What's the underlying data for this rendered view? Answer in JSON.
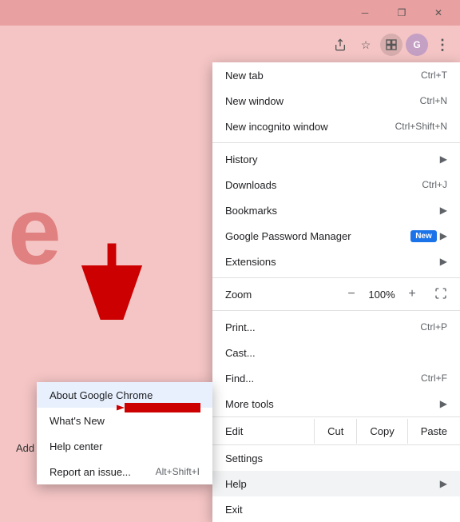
{
  "titleBar": {
    "minimizeLabel": "─",
    "restoreLabel": "❐",
    "closeLabel": "✕"
  },
  "toolbar": {
    "shareIcon": "↑",
    "favoriteIcon": "☆",
    "extensionIcon": "⬜",
    "profileIcon": "●",
    "menuIcon": "⋮"
  },
  "page": {
    "letter": "e",
    "addShortcut": "Add shortcut"
  },
  "mainMenu": {
    "items": [
      {
        "label": "New tab",
        "shortcut": "Ctrl+T",
        "arrow": false
      },
      {
        "label": "New window",
        "shortcut": "Ctrl+N",
        "arrow": false
      },
      {
        "label": "New incognito window",
        "shortcut": "Ctrl+Shift+N",
        "arrow": false
      }
    ],
    "group2": [
      {
        "label": "History",
        "shortcut": "",
        "arrow": true
      },
      {
        "label": "Downloads",
        "shortcut": "Ctrl+J",
        "arrow": false
      },
      {
        "label": "Bookmarks",
        "shortcut": "",
        "arrow": true
      },
      {
        "label": "Google Password Manager",
        "shortcut": "",
        "badge": "New",
        "arrow": true
      },
      {
        "label": "Extensions",
        "shortcut": "",
        "arrow": true
      }
    ],
    "zoom": {
      "label": "Zoom",
      "minus": "−",
      "value": "100%",
      "plus": "+",
      "fullscreen": "⛶"
    },
    "group3": [
      {
        "label": "Print...",
        "shortcut": "Ctrl+P",
        "arrow": false
      },
      {
        "label": "Cast...",
        "shortcut": "",
        "arrow": false
      },
      {
        "label": "Find...",
        "shortcut": "Ctrl+F",
        "arrow": false
      },
      {
        "label": "More tools",
        "shortcut": "",
        "arrow": true
      }
    ],
    "editRow": {
      "label": "Edit",
      "cut": "Cut",
      "copy": "Copy",
      "paste": "Paste"
    },
    "group4": [
      {
        "label": "Settings",
        "shortcut": "",
        "arrow": false
      },
      {
        "label": "Help",
        "shortcut": "",
        "arrow": true,
        "highlighted": true
      },
      {
        "label": "Exit",
        "shortcut": "",
        "arrow": false
      }
    ]
  },
  "submenu": {
    "items": [
      {
        "label": "About Google Chrome",
        "active": true
      },
      {
        "label": "What's New",
        "active": false
      },
      {
        "label": "Help center",
        "active": false
      },
      {
        "label": "Report an issue...",
        "shortcut": "Alt+Shift+I",
        "active": false
      }
    ]
  }
}
